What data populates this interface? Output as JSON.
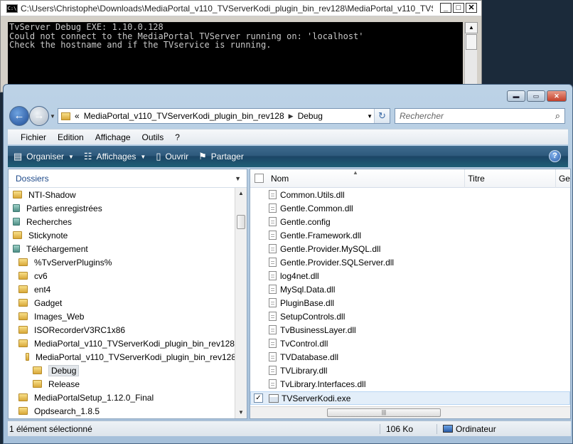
{
  "console": {
    "title": "C:\\Users\\Christophe\\Downloads\\MediaPortal_v110_TVServerKodi_plugin_bin_rev128\\MediaPortal_v110_TVSer...",
    "icon_text": "C:\\",
    "lines": [
      "TvServer Debug EXE: 1.10.0.128",
      "Could not connect to the MediaPortal TVServer running on: 'localhost'",
      "Check the hostname and if the TVservice is running."
    ]
  },
  "explorer": {
    "address": {
      "prefix": "«",
      "segments": [
        "MediaPortal_v110_TVServerKodi_plugin_bin_rev128",
        "Debug"
      ]
    },
    "search_placeholder": "Rechercher",
    "menu": [
      "Fichier",
      "Edition",
      "Affichage",
      "Outils",
      "?"
    ],
    "toolbar": {
      "organize": "Organiser",
      "views": "Affichages",
      "open": "Ouvrir",
      "share": "Partager"
    },
    "left_pane": {
      "header": "Dossiers",
      "tree": [
        {
          "label": "NTI-Shadow",
          "indent": 0,
          "special": false
        },
        {
          "label": "Parties enregistrées",
          "indent": 0,
          "special": true
        },
        {
          "label": "Recherches",
          "indent": 0,
          "special": true
        },
        {
          "label": "Stickynote",
          "indent": 0,
          "special": false
        },
        {
          "label": "Téléchargement",
          "indent": 0,
          "special": true
        },
        {
          "label": "%TvServerPlugins%",
          "indent": 1,
          "special": false
        },
        {
          "label": "cv6",
          "indent": 1,
          "special": false
        },
        {
          "label": "ent4",
          "indent": 1,
          "special": false
        },
        {
          "label": "Gadget",
          "indent": 1,
          "special": false
        },
        {
          "label": "Images_Web",
          "indent": 1,
          "special": false
        },
        {
          "label": "ISORecorderV3RC1x86",
          "indent": 1,
          "special": false
        },
        {
          "label": "MediaPortal_v110_TVServerKodi_plugin_bin_rev128",
          "indent": 1,
          "special": false
        },
        {
          "label": "MediaPortal_v110_TVServerKodi_plugin_bin_rev128",
          "indent": 2,
          "special": false
        },
        {
          "label": "Debug",
          "indent": 3,
          "special": false,
          "selected": true
        },
        {
          "label": "Release",
          "indent": 3,
          "special": false
        },
        {
          "label": "MediaPortalSetup_1.12.0_Final",
          "indent": 1,
          "special": false
        },
        {
          "label": "Opdsearch_1.8.5",
          "indent": 1,
          "special": false
        }
      ]
    },
    "columns": [
      "Nom",
      "Titre",
      "Ge"
    ],
    "files": [
      "Common.Utils.dll",
      "Gentle.Common.dll",
      "Gentle.config",
      "Gentle.Framework.dll",
      "Gentle.Provider.MySQL.dll",
      "Gentle.Provider.SQLServer.dll",
      "log4net.dll",
      "MySql.Data.dll",
      "PluginBase.dll",
      "SetupControls.dll",
      "TvBusinessLayer.dll",
      "TvControl.dll",
      "TVDatabase.dll",
      "TVLibrary.dll",
      "TvLibrary.Interfaces.dll"
    ],
    "selected_file": "TVServerKodi.exe",
    "status": {
      "selection": "1 élément sélectionné",
      "size": "106 Ko",
      "location": "Ordinateur"
    }
  }
}
